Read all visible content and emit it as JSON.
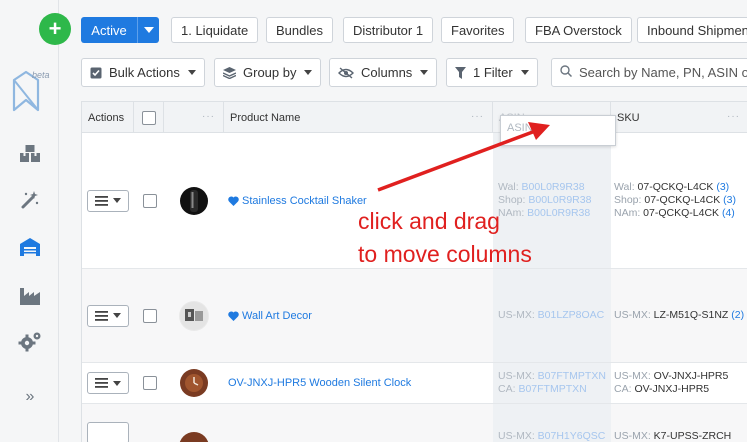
{
  "sidebar": {
    "add_label": "+",
    "logo_beta": "beta",
    "icons": [
      "inventory-icon",
      "magic-wand-icon",
      "warehouse-icon",
      "factory-icon",
      "settings-gears-icon",
      "expand-chevrons-icon"
    ],
    "expand_label": "»"
  },
  "tabs": {
    "active_label": "Active",
    "items": [
      "1. Liquidate",
      "Bundles",
      "Distributor 1",
      "Favorites",
      "FBA Overstock",
      "Inbound Shipment"
    ]
  },
  "toolbar": {
    "bulk_actions": "Bulk Actions",
    "group_by": "Group by",
    "columns": "Columns",
    "filter": "1 Filter",
    "search_placeholder": "Search by Name, PN, ASIN or SKU"
  },
  "grid": {
    "headers": {
      "actions": "Actions",
      "product_name": "Product Name",
      "asin": "ASIN",
      "sku": "SKU",
      "dots": "···"
    },
    "drag_ghost": "ASIN",
    "rows": [
      {
        "name": "Stainless Cocktail Shaker",
        "favorite": true,
        "asin": [
          {
            "k": "Wal:",
            "v": "B00L0R9R38"
          },
          {
            "k": "Shop:",
            "v": "B00L0R9R38"
          },
          {
            "k": "NAm:",
            "v": "B00L0R9R38"
          }
        ],
        "sku": [
          {
            "k": "Wal:",
            "v": "07-QCKQ-L4CK",
            "c": "(3)"
          },
          {
            "k": "Shop:",
            "v": "07-QCKQ-L4CK",
            "c": "(3)"
          },
          {
            "k": "NAm:",
            "v": "07-QCKQ-L4CK",
            "c": "(4)"
          }
        ]
      },
      {
        "name": "Wall Art Decor",
        "favorite": true,
        "asin": [
          {
            "k": "US-MX:",
            "v": "B01LZP8OAC"
          }
        ],
        "sku": [
          {
            "k": "US-MX:",
            "v": "LZ-M51Q-S1NZ",
            "c": "(2)"
          }
        ]
      },
      {
        "name": "OV-JNXJ-HPR5 Wooden Silent Clock",
        "favorite": false,
        "asin": [
          {
            "k": "US-MX:",
            "v": "B07FTMPTXN"
          },
          {
            "k": "CA:",
            "v": "B07FTMPTXN"
          }
        ],
        "sku": [
          {
            "k": "US-MX:",
            "v": "OV-JNXJ-HPR5",
            "c": ""
          },
          {
            "k": "CA:",
            "v": "OV-JNXJ-HPR5",
            "c": ""
          }
        ]
      },
      {
        "name": "",
        "favorite": false,
        "asin": [
          {
            "k": "US-MX:",
            "v": "B07H1Y6QSC"
          }
        ],
        "sku": [
          {
            "k": "US-MX:",
            "v": "K7-UPSS-ZRCH",
            "c": ""
          }
        ]
      }
    ]
  },
  "annotation": {
    "line1": "click and drag",
    "line2": "to move columns",
    "color": "#e0201f"
  },
  "colors": {
    "accent": "#1f7ae0",
    "add_button": "#2eb84a"
  }
}
